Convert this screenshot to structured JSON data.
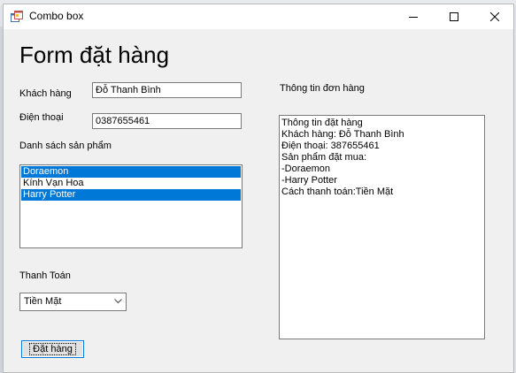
{
  "window": {
    "title": "Combo box"
  },
  "form": {
    "heading": "Form đặt hàng",
    "customer_label": "Khách hàng",
    "customer_value": "Đỗ Thanh Bình",
    "phone_label": "Điện thoại",
    "phone_value": "0387655461",
    "products_label": "Danh sách sản phẩm",
    "products": [
      {
        "label": "Doraemon",
        "selected": true
      },
      {
        "label": "Kính Vạn Hoa",
        "selected": false
      },
      {
        "label": "Harry Potter",
        "selected": true
      }
    ],
    "payment_label": "Thanh Toán",
    "payment_value": "Tiền Mặt",
    "order_button": "Đặt hàng",
    "order_info_label": "Thông tin đơn hàng",
    "order_info_lines": [
      "Thông tin đặt hàng",
      "Khách hàng: Đỗ Thanh Bình",
      "Điện thoại: 387655461",
      "Sản phẩm đặt mua:",
      "-Doraemon",
      "-Harry Potter",
      "Cách thanh toán:Tiền Mặt"
    ]
  },
  "colors": {
    "selection": "#0078d7",
    "window_bg": "#f0f0f0"
  }
}
